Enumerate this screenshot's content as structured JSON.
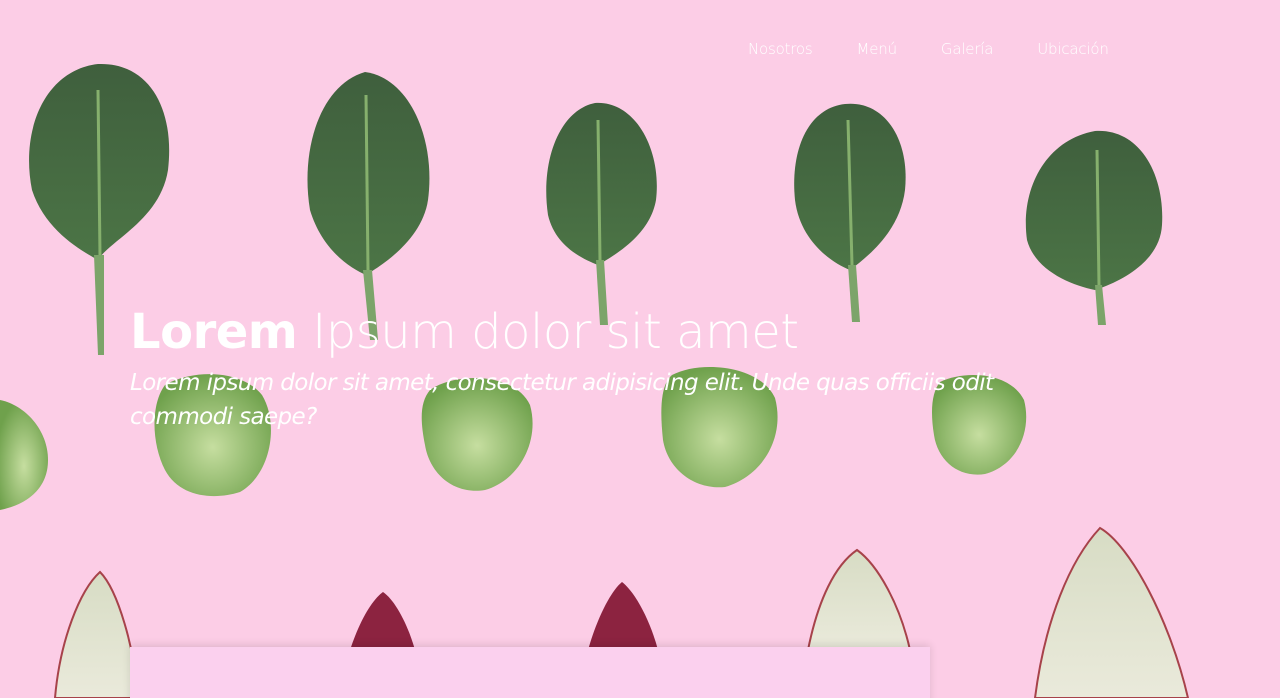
{
  "colors": {
    "background": "#fccde6",
    "text": "#ffffff",
    "card": "#fbd0ee"
  },
  "nav": {
    "items": [
      {
        "label": "Nosotros"
      },
      {
        "label": "Menú"
      },
      {
        "label": "Galería"
      },
      {
        "label": "Ubicación"
      }
    ]
  },
  "hero": {
    "title_bold": "Lorem",
    "title_rest": " Ipsum dolor sit amet",
    "subtitle": "Lorem ipsum dolor sit amet, consectetur adipisicing elit. Unde quas officiis odit commodi saepe?"
  }
}
